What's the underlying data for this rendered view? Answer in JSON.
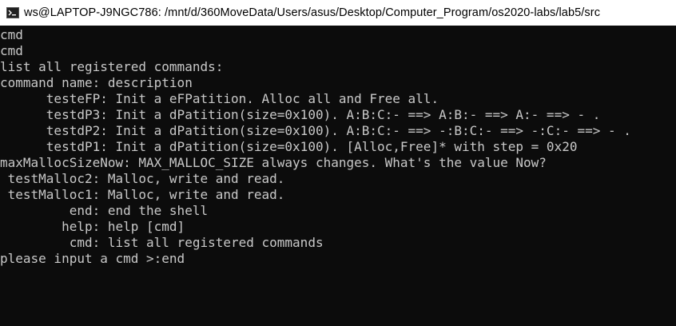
{
  "window": {
    "title": "ws@LAPTOP-J9NGC786: /mnt/d/360MoveData/Users/asus/Desktop/Computer_Program/os2020-labs/lab5/src",
    "icon": "linux-terminal-icon",
    "colors": {
      "titlebar_bg": "#ffffff",
      "console_bg": "#0c0c0c",
      "console_fg": "#c8c8c8"
    }
  },
  "console": {
    "lines": [
      "cmd",
      "cmd",
      "list all registered commands:",
      "command name: description",
      "      testeFP: Init a eFPatition. Alloc all and Free all.",
      "      testdP3: Init a dPatition(size=0x100). A:B:C:- ==> A:B:- ==> A:- ==> - .",
      "      testdP2: Init a dPatition(size=0x100). A:B:C:- ==> -:B:C:- ==> -:C:- ==> - .",
      "      testdP1: Init a dPatition(size=0x100). [Alloc,Free]* with step = 0x20",
      "maxMallocSizeNow: MAX_MALLOC_SIZE always changes. What's the value Now?",
      " testMalloc2: Malloc, write and read.",
      " testMalloc1: Malloc, write and read.",
      "         end: end the shell",
      "        help: help [cmd]",
      "         cmd: list all registered commands",
      "please input a cmd >:end"
    ]
  }
}
